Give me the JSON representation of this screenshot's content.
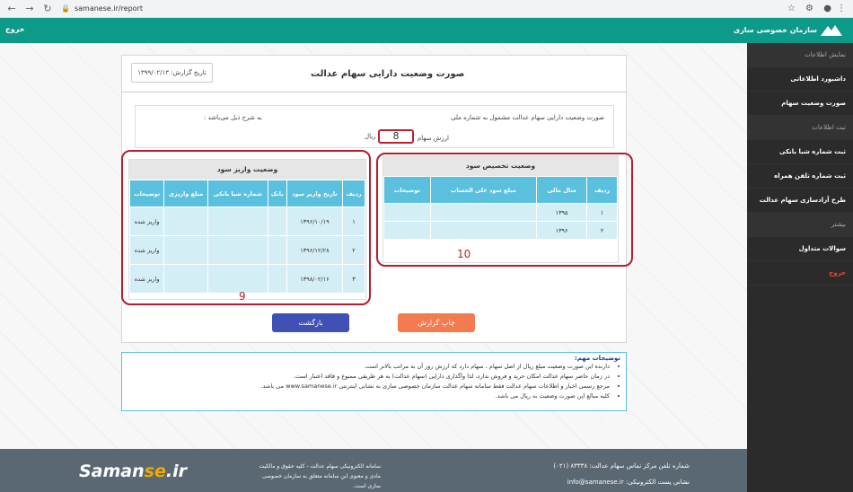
{
  "browser": {
    "url": "samanese.ir/report"
  },
  "topbar": {
    "logout": "خروج",
    "brand": "سازمان خصوصی سازی"
  },
  "sidebar": {
    "items": [
      {
        "label": "نمایش اطلاعات",
        "type": "sec"
      },
      {
        "label": "داشبورد اطلاعاتی",
        "type": "item"
      },
      {
        "label": "صورت وضعیت سهام",
        "type": "item"
      },
      {
        "label": "ثبت اطلاعات",
        "type": "sec"
      },
      {
        "label": "ثبت شماره شبا بانکی",
        "type": "item"
      },
      {
        "label": "ثبت شماره تلفن همراه",
        "type": "item"
      },
      {
        "label": "طرح آزادسازی سهام عدالت",
        "type": "item"
      },
      {
        "label": "بیشتر",
        "type": "sec"
      },
      {
        "label": "سوالات متداول",
        "type": "item"
      },
      {
        "label": "خروج",
        "type": "red"
      }
    ]
  },
  "report": {
    "title": "صورت وضعیت دارایی سهام عدالت",
    "date": "تاریخ گزارش: ۱۳۹۹/۰۲/۱۳",
    "info_line1": "صورت وضعیت دارایی سهام عدالت مشمول به شماره ملی",
    "info_line1b": "به شرح ذیل می‌باشد :",
    "value_label": "ارزش سهام",
    "value": "8",
    "unit": "ریال"
  },
  "allocation": {
    "title": "وضعیت تخصیص سود",
    "headers": [
      "ردیف",
      "سال مالی",
      "مبلغ سود علی الحساب",
      "توضیحات"
    ],
    "rows": [
      [
        "۱",
        "۱۳۹۵",
        "",
        ""
      ],
      [
        "۲",
        "۱۳۹۶",
        "",
        ""
      ]
    ]
  },
  "deposit": {
    "title": "وضعیت واریز سود",
    "headers": [
      "ردیف",
      "تاریخ واریز سود",
      "بانک",
      "شماره شبا بانکی",
      "مبلغ واریزی",
      "توضیحات"
    ],
    "rows": [
      [
        "۱",
        "۱۳۹۶/۱۰/۱۹",
        "",
        "",
        "",
        "واریز شده"
      ],
      [
        "۲",
        "۱۳۹۶/۱۲/۲۸",
        "",
        "",
        "",
        "واریز شده"
      ],
      [
        "۳",
        "۱۳۹۸/۰۲/۱۶",
        "",
        "",
        "",
        "واریز شده"
      ]
    ]
  },
  "annotations": {
    "a8": "8",
    "a9": "9",
    "a10": "10"
  },
  "buttons": {
    "print": "چاپ گزارش",
    "back": "بازگشت"
  },
  "notes": {
    "title": "توضیحات مهم:",
    "items": [
      "دارنده این صورت وضعیت مبلغ            ریال از اصل سهام ، سهام دارد که ارزش روز آن به مراتب بالاتر است.",
      "در زمان حاضر سهام عدالت امکان خرید و فروش ندارد، لذا واگذاری دارایی (سهام عدالت) به هر طریقی ممنوع و فاقد اعتبار است.",
      "مرجع رسمی اخبار و اطلاعات سهام عدالت فقط سامانه سهام عدالت سازمان خصوصی سازی به نشانی اینترنتی www.samanese.ir می باشد.",
      "کلیه مبالغ این صورت وضعیت به ریال می باشد."
    ]
  },
  "footer": {
    "logo_a": "Saman",
    "logo_b": "se",
    "logo_c": ".ir",
    "mid": "سامانه الکترونیکی سهام عدالت - کلیه حقوق و مالکیت مادی و معنوی این سامانه متعلق به سازمان خصوصی سازی است.",
    "phone": "شماره تلفن مرکز تماس سهام عدالت: ۸۳۳۳۸ (۰۲۱)",
    "email": "نشانی پست الکترونیکی: info@samanese.ir"
  }
}
